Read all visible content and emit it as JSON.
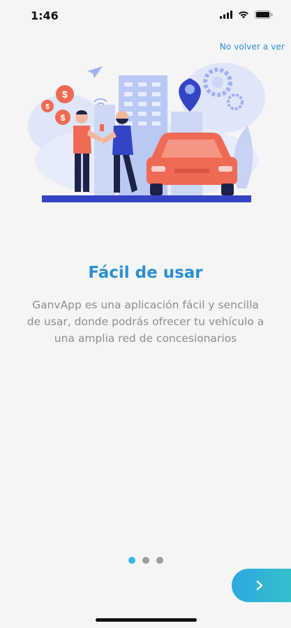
{
  "status_bar": {
    "time": "1:46",
    "icons": [
      "signal-icon",
      "wifi-icon",
      "battery-icon"
    ]
  },
  "header": {
    "skip_label": "No volver a ver"
  },
  "illustration": {
    "name": "handshake-car-illustration",
    "colors": {
      "primary": "#3344c4",
      "light_blue": "#c9d6f4",
      "coral": "#ef6a55",
      "dark": "#1d2348"
    }
  },
  "slide": {
    "title": "Fácil de usar",
    "description": "GanvApp es una aplicación fácil y sencilla de usar, donde podrás ofrecer tu vehículo a una amplia red de concesionarios"
  },
  "pager": {
    "total": 3,
    "active_index": 0
  },
  "next_button": {
    "icon": "chevron-right-icon"
  },
  "colors": {
    "accent": "#2a8fd4",
    "background": "#f5f5f6",
    "text_muted": "#8d8d8d",
    "dot_active": "#35b6e6",
    "dot_inactive": "#9e9e9e"
  }
}
